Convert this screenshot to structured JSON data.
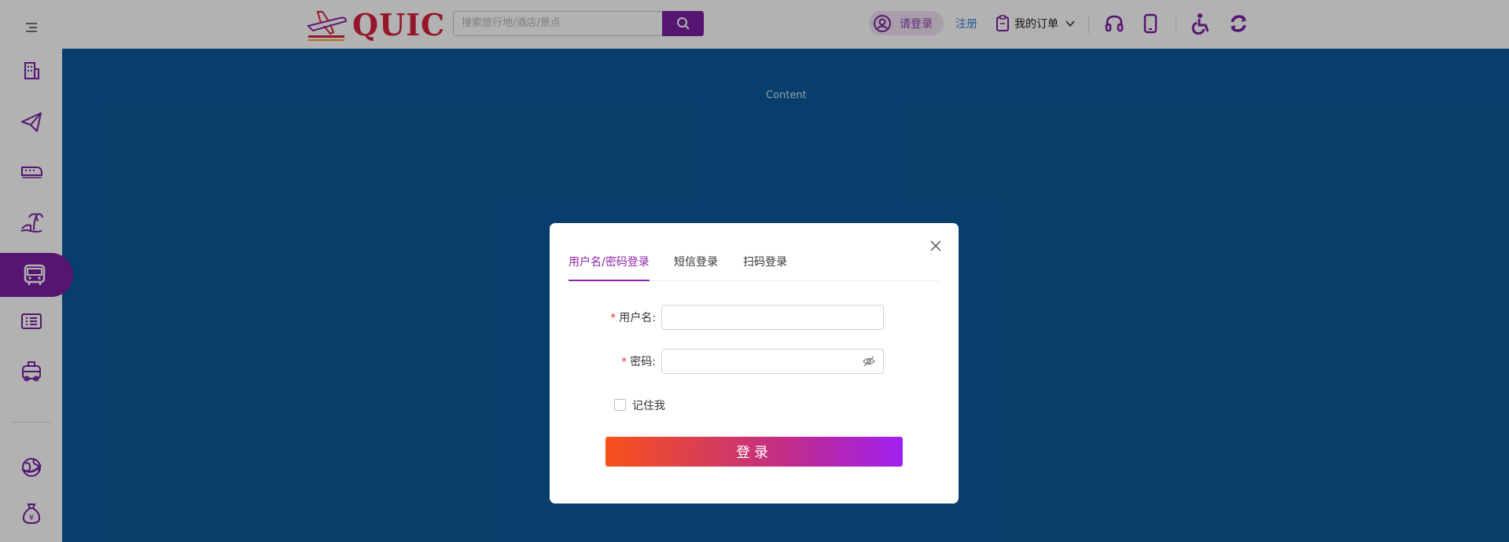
{
  "brand": {
    "logo_text": "QUIC",
    "accent": "#7b1fa2",
    "logo_color": "#d4233b"
  },
  "header": {
    "search_placeholder": "搜索旅行地/酒店/景点",
    "login_label": "请登录",
    "register_label": "注册",
    "orders_label": "我的订单",
    "icons": [
      "search-icon",
      "user-icon",
      "clipboard-icon",
      "chevron-down-icon",
      "headset-icon",
      "mobile-icon",
      "accessibility-icon",
      "refresh-icon"
    ]
  },
  "sidebar": {
    "items": [
      "menu-icon",
      "hotel-icon",
      "flight-icon",
      "train-icon",
      "vacation-icon",
      "bus-icon",
      "ticket-icon",
      "car-icon",
      "globe-icon",
      "money-bag-icon"
    ],
    "active": "bus-icon"
  },
  "content": {
    "label": "Content"
  },
  "modal": {
    "tabs": [
      {
        "label": "用户名/密码登录"
      },
      {
        "label": "短信登录"
      },
      {
        "label": "扫码登录"
      }
    ],
    "username_label": "用户名:",
    "password_label": "密码:",
    "required_mark": "*",
    "remember_label": "记住我",
    "submit_label": "登录",
    "username_value": "",
    "password_value": ""
  }
}
